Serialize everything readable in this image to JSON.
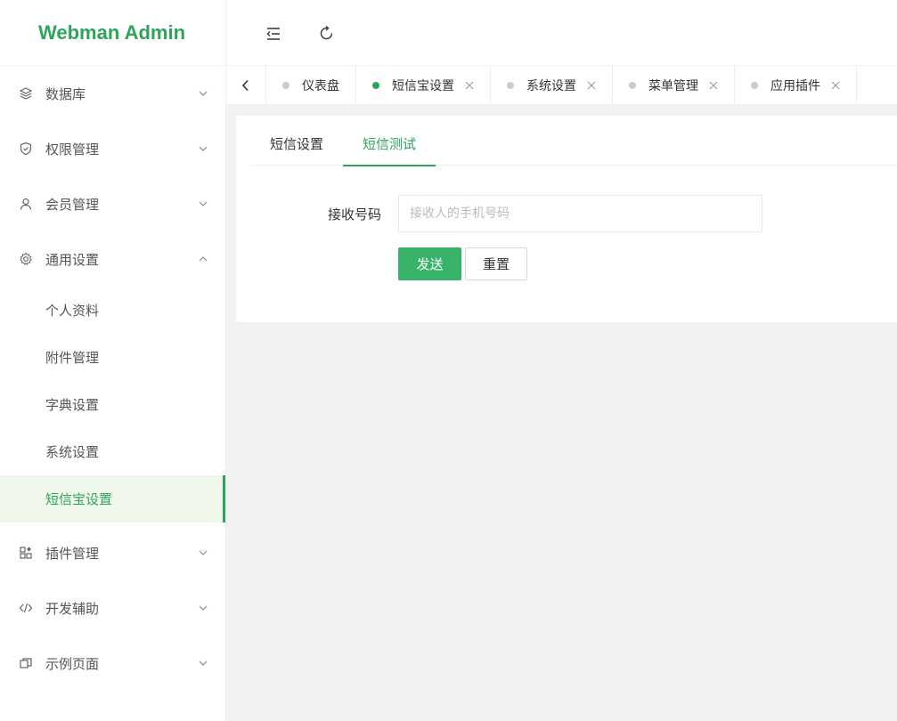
{
  "app": {
    "title": "Webman Admin"
  },
  "header": {
    "toggle_icon": "menu-fold-icon",
    "refresh_icon": "refresh-icon"
  },
  "sidebar": {
    "items": [
      {
        "label": "数据库",
        "icon": "database-icon",
        "expanded": false
      },
      {
        "label": "权限管理",
        "icon": "shield-icon",
        "expanded": false
      },
      {
        "label": "会员管理",
        "icon": "user-icon",
        "expanded": false
      },
      {
        "label": "通用设置",
        "icon": "gear-icon",
        "expanded": true,
        "children": [
          "个人资料",
          "附件管理",
          "字典设置",
          "系统设置",
          "短信宝设置"
        ]
      },
      {
        "label": "插件管理",
        "icon": "plugin-icon",
        "expanded": false
      },
      {
        "label": "开发辅助",
        "icon": "code-icon",
        "expanded": false
      },
      {
        "label": "示例页面",
        "icon": "page-icon",
        "expanded": false
      }
    ],
    "active_child": "短信宝设置"
  },
  "tabs": [
    {
      "label": "仪表盘",
      "active": false,
      "closable": false
    },
    {
      "label": "短信宝设置",
      "active": true,
      "closable": true
    },
    {
      "label": "系统设置",
      "active": false,
      "closable": true
    },
    {
      "label": "菜单管理",
      "active": false,
      "closable": true
    },
    {
      "label": "应用插件",
      "active": false,
      "closable": true
    }
  ],
  "content": {
    "subtabs": [
      "短信设置",
      "短信测试"
    ],
    "active_subtab": "短信测试",
    "form": {
      "phone_label": "接收号码",
      "phone_placeholder": "接收人的手机号码",
      "phone_value": "",
      "submit_label": "发送",
      "reset_label": "重置"
    }
  },
  "colors": {
    "accent": "#2ea45a",
    "button": "#36b368",
    "active_bg": "#eef7ea"
  }
}
